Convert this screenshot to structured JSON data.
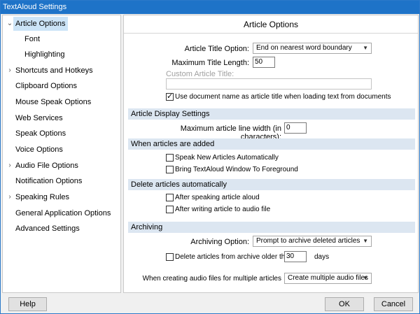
{
  "window": {
    "title": "TextAloud Settings"
  },
  "sidebar": {
    "items": [
      {
        "label": "Article Options",
        "expanded": true,
        "selected": true
      },
      {
        "label": "Font",
        "child": true
      },
      {
        "label": "Highlighting",
        "child": true
      },
      {
        "label": "Shortcuts and Hotkeys",
        "expandable": true
      },
      {
        "label": "Clipboard Options"
      },
      {
        "label": "Mouse Speak Options"
      },
      {
        "label": "Web Services"
      },
      {
        "label": "Speak Options"
      },
      {
        "label": "Voice Options"
      },
      {
        "label": "Audio File Options",
        "expandable": true
      },
      {
        "label": "Notification Options"
      },
      {
        "label": "Speaking Rules",
        "expandable": true
      },
      {
        "label": "General Application Options"
      },
      {
        "label": "Advanced Settings"
      }
    ]
  },
  "main": {
    "title": "Article Options",
    "article_title_option": {
      "label": "Article Title Option:",
      "value": "End on nearest word boundary"
    },
    "max_title_length": {
      "label": "Maximum Title Length:",
      "value": "50"
    },
    "custom_article_title": {
      "label": "Custom Article Title:",
      "value": ""
    },
    "use_doc_name": {
      "label": "Use document name as article title when loading text from documents",
      "checked": true
    },
    "display_section": {
      "header": "Article Display Settings",
      "max_line_width": {
        "label": "Maximum article line width (in characters):",
        "value": "0"
      }
    },
    "added_section": {
      "header": "When articles are added",
      "speak_new": {
        "label": "Speak New Articles Automatically",
        "checked": false
      },
      "bring_foreground": {
        "label": "Bring TextAloud Window To Foreground",
        "checked": false
      }
    },
    "delete_section": {
      "header": "Delete articles automatically",
      "after_speaking": {
        "label": "After speaking article aloud",
        "checked": false
      },
      "after_writing": {
        "label": "After writing article to audio file",
        "checked": false
      }
    },
    "archiving_section": {
      "header": "Archiving",
      "archiving_option": {
        "label": "Archiving Option:",
        "value": "Prompt to archive deleted articles"
      },
      "delete_older": {
        "label": "Delete articles from archive older than",
        "checked": false,
        "value": "30",
        "unit": "days"
      },
      "multiple_files": {
        "label": "When creating audio files for multiple articles",
        "value": "Create multiple audio files"
      }
    }
  },
  "buttons": {
    "help": "Help",
    "ok": "OK",
    "cancel": "Cancel"
  },
  "colors": {
    "titlebar": "#1e73c8",
    "section_header": "#dce6f1",
    "selection": "#cce4f7"
  }
}
